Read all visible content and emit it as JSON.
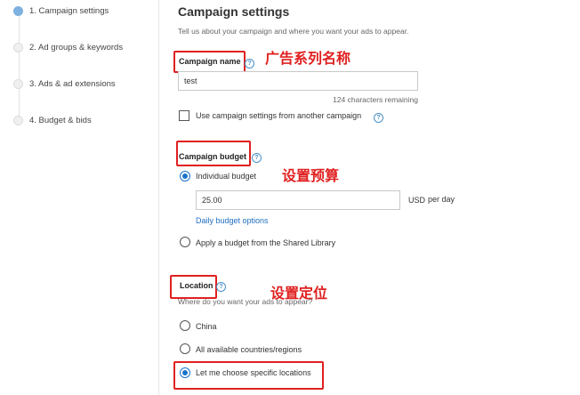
{
  "steps": [
    {
      "label": "1. Campaign settings",
      "active": true
    },
    {
      "label": "2. Ad groups & keywords",
      "active": false
    },
    {
      "label": "3. Ads & ad extensions",
      "active": false
    },
    {
      "label": "4. Budget & bids",
      "active": false
    }
  ],
  "header": {
    "title": "Campaign settings",
    "subtitle": "Tell us about your campaign and where you want your ads to appear."
  },
  "campaign_name": {
    "label": "Campaign name",
    "value": "test",
    "remaining": "124 characters remaining",
    "copy_option": "Use campaign settings from another campaign",
    "annotation": "广告系列名称"
  },
  "budget": {
    "label": "Campaign budget",
    "individual": "Individual budget",
    "amount": "25.00",
    "currency": "USD",
    "period": "per day",
    "options_link": "Daily budget options",
    "shared": "Apply a budget from the Shared Library",
    "annotation": "设置预算"
  },
  "location": {
    "label": "Location",
    "question": "Where do you want your ads to appear?",
    "options": [
      "China",
      "All available countries/regions",
      "Let me choose specific locations"
    ],
    "annotation": "设置定位"
  },
  "colors": {
    "accent": "#1a73c9",
    "annotation": "#e02020",
    "step_active": "#7eb0e0"
  }
}
